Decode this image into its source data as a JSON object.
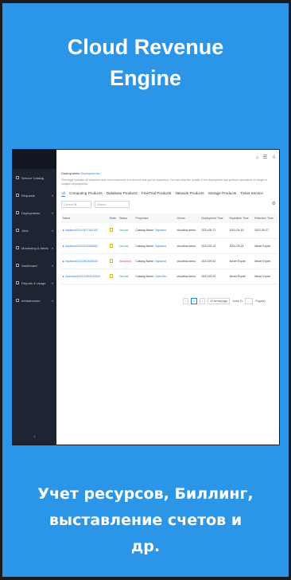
{
  "title": {
    "line1": "Cloud Revenue",
    "line2": "Engine"
  },
  "caption": {
    "line1": "Учет ресурсов, Биллинг,",
    "line2": "выставление счетов и",
    "line3": "др."
  },
  "colors": {
    "accent": "#2b96e8",
    "background": "#181a1c",
    "link": "#2a7ae2"
  },
  "screenshot": {
    "sidebar": {
      "items": [
        {
          "label": "Service Catalog",
          "icon": "catalog-icon"
        },
        {
          "label": "Requests",
          "icon": "requests-icon",
          "chevron": "▾"
        },
        {
          "label": "Deployments",
          "icon": "deployments-icon",
          "chevron": "▾"
        },
        {
          "label": "Jobs",
          "icon": "jobs-icon",
          "chevron": "▾"
        },
        {
          "label": "Monitoring & Alerts",
          "icon": "monitoring-icon",
          "chevron": "▾"
        },
        {
          "label": "Dashboard",
          "icon": "dashboard-icon",
          "chevron": "▾"
        },
        {
          "label": "Reports & Usage",
          "icon": "reports-icon",
          "chevron": "▾"
        },
        {
          "label": "Infrastructure",
          "icon": "infrastructure-icon",
          "chevron": "▾"
        }
      ],
      "collapse": "‹"
    },
    "topbar_icons": "⌂ ☰ ⇩",
    "breadcrumb": {
      "prefix": "Deployments",
      "link": "Deployments /"
    },
    "description": "This page includes all instances and cloud resources in a service that you've requested. You can view the details of the deployment and perform operations on single or multiple deployments.",
    "tabs": [
      "All",
      "Computing Products",
      "Database Products",
      "FreeTrial Products",
      "Network Products",
      "Storage Products",
      "Ticket Service"
    ],
    "filter_placeholder": "Current All",
    "search_placeholder": "Search...",
    "columns": [
      "Name",
      "State",
      "Status",
      "Properties",
      "Owner",
      "Deployment Time",
      "Expiration Time",
      "Retention Time"
    ],
    "rows": [
      {
        "name": "Vapiwest20210817164100",
        "status": "Normal",
        "status_kind": "normal",
        "prop_label": "Catalog Name:",
        "prop_value": "Vapiwest",
        "owner": "cloudbss demo",
        "deploy": "2021-08-17",
        "expire": "2021-09-15",
        "retain": "2021-09-27"
      },
      {
        "name": "Vapiwest20210912050832",
        "status": "Normal",
        "status_kind": "normal",
        "prop_label": "Catalog Name:",
        "prop_value": "Vapiwest",
        "owner": "cloudbss demo",
        "deploy": "2021-09-12",
        "expire": "2021-09-14",
        "retain": "Never Expire"
      },
      {
        "name": "Vapiwest20210902040843",
        "status": "Abnormal",
        "status_kind": "abnormal",
        "prop_label": "Catalog Name:",
        "prop_value": "Vapiwest",
        "owner": "cloudbss demo",
        "deploy": "2021-09-02",
        "expire": "Never Expire",
        "retain": "Never Expire"
      },
      {
        "name": "Openstack20210902040843",
        "status": "Normal",
        "status_kind": "normal",
        "prop_label": "Catalog Name:",
        "prop_value": "OpenSta...",
        "owner": "cloudbss demo",
        "deploy": "2021-09-02",
        "expire": "Never Expire",
        "retain": "Never Expire"
      }
    ],
    "pager": {
      "prev": "‹",
      "current": "1",
      "next": "›",
      "page_size": "20 items/page",
      "jump": "Jump To",
      "page": "Page(s)"
    }
  }
}
